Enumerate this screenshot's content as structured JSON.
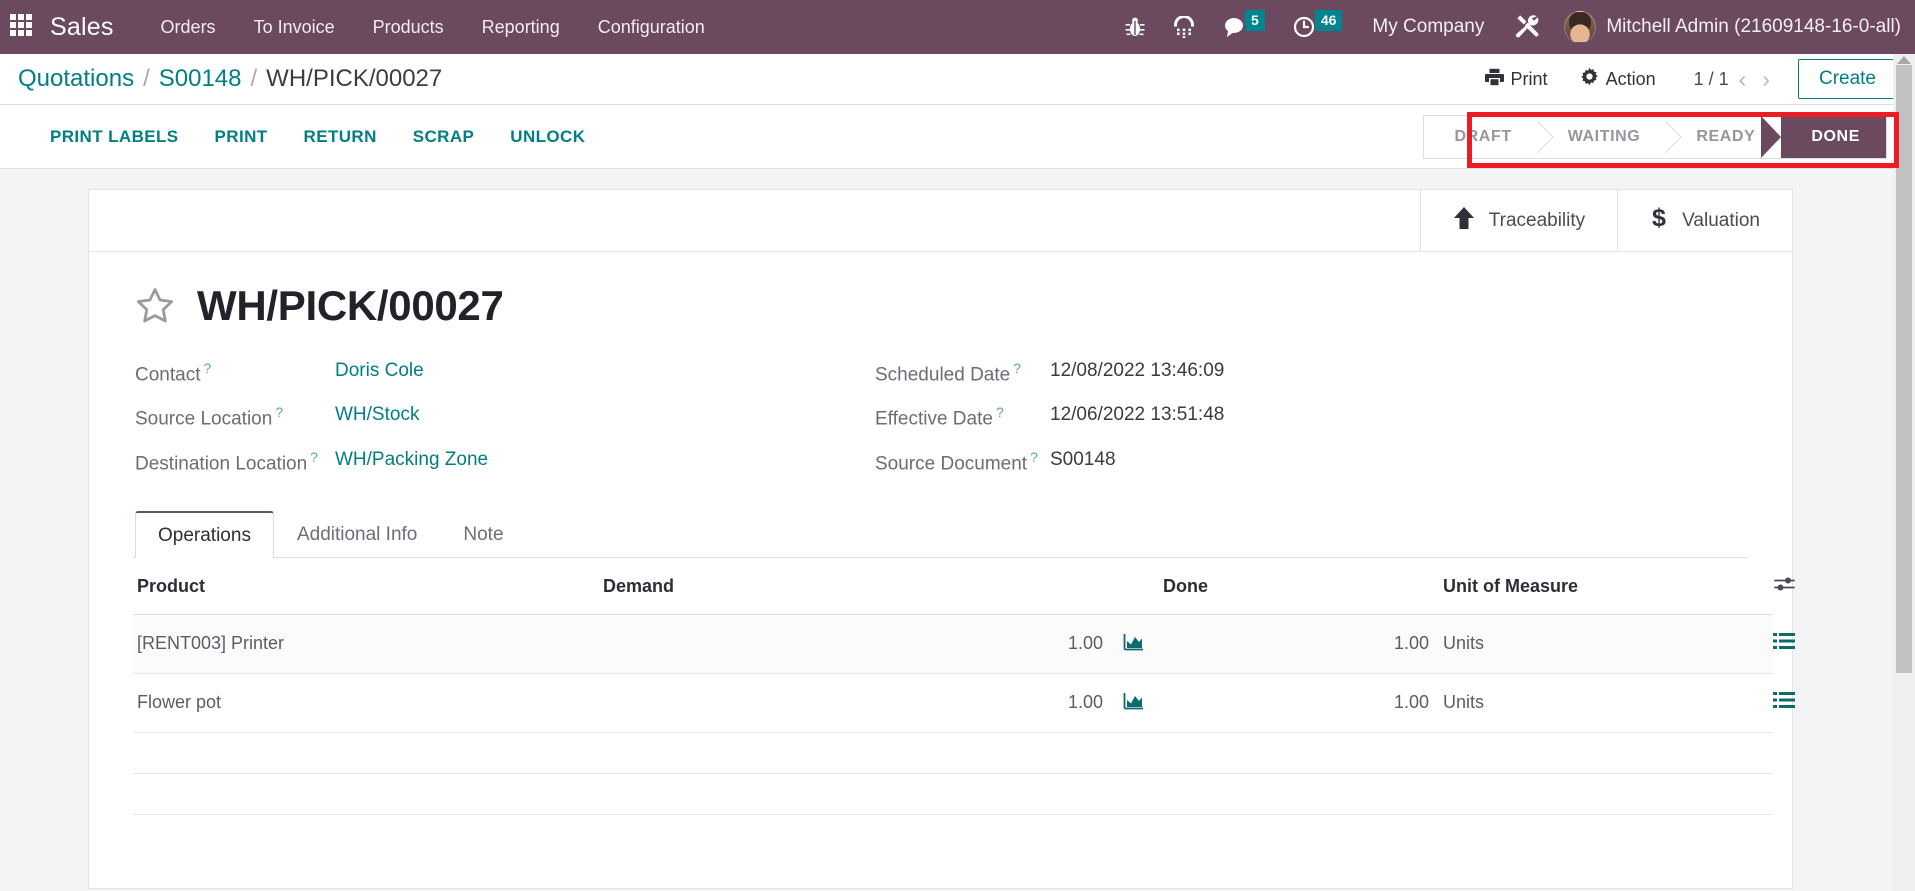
{
  "navbar": {
    "apps_icon": "apps-grid-icon",
    "brand": "Sales",
    "menu": [
      {
        "label": "Orders"
      },
      {
        "label": "To Invoice"
      },
      {
        "label": "Products"
      },
      {
        "label": "Reporting"
      },
      {
        "label": "Configuration"
      }
    ],
    "icons": [
      {
        "name": "bug-icon",
        "glyph": "🐞"
      },
      {
        "name": "dialpad-icon",
        "glyph": "☷"
      }
    ],
    "messages": {
      "name": "chat-icon",
      "count": "5"
    },
    "activities": {
      "name": "clock-icon",
      "count": "46"
    },
    "company": "My Company",
    "tools_icon": "wrench-screwdriver-icon",
    "user": "Mitchell Admin (21609148-16-0-all)"
  },
  "control_panel": {
    "breadcrumb": [
      {
        "label": "Quotations",
        "link": true
      },
      {
        "label": "S00148",
        "link": true
      },
      {
        "label": "WH/PICK/00027",
        "link": false
      }
    ],
    "separator": "/",
    "print_label": "Print",
    "action_label": "Action",
    "pager": "1 / 1",
    "prev_icon": "chevron-left-icon",
    "next_icon": "chevron-right-icon",
    "create_label": "Create"
  },
  "action_bar": {
    "buttons": [
      {
        "label": "PRINT LABELS"
      },
      {
        "label": "PRINT"
      },
      {
        "label": "RETURN"
      },
      {
        "label": "SCRAP"
      },
      {
        "label": "UNLOCK"
      }
    ],
    "statuses": [
      {
        "label": "DRAFT",
        "active": false
      },
      {
        "label": "WAITING",
        "active": false
      },
      {
        "label": "READY",
        "active": false
      },
      {
        "label": "DONE",
        "active": true
      }
    ],
    "highlight_color": "#ec1c24"
  },
  "smart_buttons": [
    {
      "label": "Traceability",
      "icon": "up-arrow-icon"
    },
    {
      "label": "Valuation",
      "icon": "dollar-icon"
    }
  ],
  "record": {
    "title": "WH/PICK/00027",
    "star_icon": "star-outline-icon",
    "fields_left": [
      {
        "label": "Contact",
        "value": "Doris Cole",
        "link": true,
        "help": "?"
      },
      {
        "label": "Source Location",
        "value": "WH/Stock",
        "link": true,
        "help": "?"
      },
      {
        "label": "Destination Location",
        "value": "WH/Packing Zone",
        "link": true,
        "help": "?"
      }
    ],
    "fields_right": [
      {
        "label": "Scheduled Date",
        "value": "12/08/2022 13:46:09",
        "link": false,
        "help": "?"
      },
      {
        "label": "Effective Date",
        "value": "12/06/2022 13:51:48",
        "link": false,
        "help": "?"
      },
      {
        "label": "Source Document",
        "value": "S00148",
        "link": false,
        "help": "?"
      }
    ]
  },
  "notebook": {
    "tabs": [
      {
        "label": "Operations",
        "active": true
      },
      {
        "label": "Additional Info",
        "active": false
      },
      {
        "label": "Note",
        "active": false
      }
    ],
    "table": {
      "headers": [
        "Product",
        "Demand",
        "Done",
        "Unit of Measure"
      ],
      "optional_columns_icon": "sliders-icon",
      "rows": [
        {
          "product": "[RENT003] Printer",
          "demand": "1.00",
          "forecast_icon": "forecast-chart-icon",
          "done": "1.00",
          "uom": "Units",
          "detail_icon": "list-detail-icon"
        },
        {
          "product": "Flower pot",
          "demand": "1.00",
          "forecast_icon": "forecast-chart-icon",
          "done": "1.00",
          "uom": "Units",
          "detail_icon": "list-detail-icon"
        }
      ]
    }
  },
  "colors": {
    "brand_purple": "#6b4a5f",
    "accent_teal": "#017e84",
    "badge_teal": "#00848e",
    "highlight_red": "#ec1c24"
  }
}
